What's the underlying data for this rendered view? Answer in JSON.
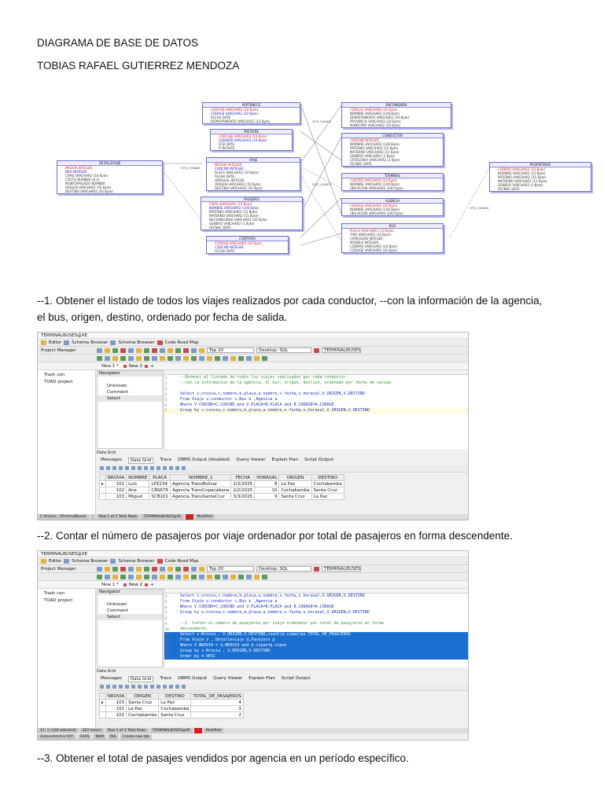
{
  "title": "DIAGRAMA DE BASE DE DATOS",
  "author": "TOBIAS RAFAEL  GUTIERREZ MENDOZA",
  "diagram": {
    "entities": [
      {
        "name": "DETALLEVIAJE",
        "cols": [
          "NROVIA  INTEGER",
          "NRO  INTEGER",
          "CIPAS  VARCHAR2 (10 Byte)",
          "COSTO  NUMBER (6,2)",
          "MONTOPAGADO  NUMBER",
          "ORIGEN  VARCHAR2 (50 Byte)",
          "DESTINO  VARCHAR2 (50 Byte)"
        ]
      },
      {
        "name": "PERTENECE",
        "cols": [
          "CODCAR  VARCHAR2 (10 Byte)",
          "CODAGE  VARCHAR2 (10 Byte)",
          "FECHA  DATE",
          "DEPARTAMENTO  VARCHAR2 (10 Byte)"
        ]
      },
      {
        "name": "PREFIERE",
        "cols": [
          "CODCAJE  VARCHAR2 (10 Byte)",
          "CODHERI  VARCHAR2 (10 Byte)",
          "FFEI  DATE",
          "FFIN  DATE"
        ]
      },
      {
        "name": "VIAJE",
        "cols": [
          "NROVIA  INTEGER",
          "CODCND  INTEGER",
          "PLACA  VARCHAR2 (10 Byte)",
          "FECHA  DATE",
          "HORASAL  INTEGER",
          "ORIGEN  VARCHAR2 (50 Byte)",
          "DESTINO  VARCHAR2 (50 Byte)"
        ]
      },
      {
        "name": "PASAJERO",
        "cols": [
          "CIPAS  VARCHAR2 (10 Byte)",
          "NOMBRE  VARCHAR2 (100 Byte)",
          "PATERNO  VARCHAR2 (15 Byte)",
          "MATERNO  VARCHAR2 (15 Byte)",
          "NACIONALIDAD  VARCHAR2 (20 Byte)",
          "GENERO  VARCHAR2 (1 Byte)",
          "FECNAC  DATE"
        ]
      },
      {
        "name": "CONTRATA",
        "cols": [
          "CODAGE  VARCHAR2 (10 Byte)",
          "CODCND  INTEGER",
          "FECHA  DATE"
        ]
      },
      {
        "name": "ENCOMIENDA",
        "cols": [
          "CODLUG  VARCHAR2 (10 Byte)",
          "NOMBRE  VARCHAR2 (100 Byte)",
          "DEPARTAMENTO  VARCHAR2 (20 Byte)",
          "PROVINCIA  VARCHAR2 (20 Byte)",
          "MUNICIPIO  VARCHAR2 (20 Byte)"
        ]
      },
      {
        "name": "CONDUCTOR",
        "cols": [
          "CODCND  INTEGER",
          "NOMBRE  VARCHAR2 (100 Byte)",
          "PATERNO  VARCHAR2 (15 Byte)",
          "MATERNO  VARCHAR2 (15 Byte)",
          "GENERO  VARCHAR2 (1 Byte)",
          "CATEGORIA  VARCHAR2 (1 Byte)",
          "FECNAC  DATE"
        ]
      },
      {
        "name": "TERMINAL",
        "cols": [
          "CODTER  VARCHAR2 (10 Byte)",
          "NOMBRE  VARCHAR2 (100 Byte)",
          "UBICACION  VARCHAR2 (200 Byte)"
        ]
      },
      {
        "name": "AGENCIA",
        "cols": [
          "CODAGE  VARCHAR2 (10 Byte)",
          "NOMBRE  VARCHAR2 (100 Byte)",
          "UBICACION  VARCHAR2 (200 Byte)"
        ]
      },
      {
        "name": "BUS",
        "cols": [
          "PLACA  VARCHAR2 (10 Byte)",
          "TIPO  VARCHAR2 (10 Byte)",
          "CAPACIDAD  INTEGER",
          "MODELO  INTEGER",
          "CODPRO  VARCHAR2 (10 Byte)",
          "CODAGE  VARCHAR2 (10 Byte)"
        ]
      },
      {
        "name": "PROPIETARIO",
        "cols": [
          "CODPRO  VARCHAR2 (10 Byte)",
          "NOMBRE  VARCHAR2 (15 Byte)",
          "PATERNO  VARCHAR2 (15 Byte)",
          "MATERNO  VARCHAR2 (15 Byte)",
          "GENERO  VARCHAR2 (1 Byte)",
          "FECNAC  DATE"
        ]
      }
    ],
    "links": [
      "SYS_C00869",
      "SYS_C00874",
      "SYS_C00871",
      "SYS_C00878"
    ]
  },
  "q1": {
    "line1": "--1. Obtener el listado de todos los viajes realizados por cada conductor, --con la información de la agencia,",
    "line2": "el bus, origen, destino, ordenado por fecha de salida.",
    "window_title": "TERMINALBUSES@XE",
    "toolbar": {
      "editor": "Editor",
      "schema": "Schema Browser",
      "schema2": "Schema Browser",
      "roadmap": "Code Road Map",
      "top": "Top 20",
      "desktop": "Desktop: SQL",
      "conn": "TERMINALBUSES"
    },
    "project": {
      "title": "Project Manager",
      "items": [
        "Trash can",
        "TOAD project"
      ]
    },
    "tabs": [
      "New 1 *",
      "New 2"
    ],
    "navigator": {
      "title": "Navigator",
      "items": [
        "Unknown",
        "Comment",
        "Select"
      ]
    },
    "sql": [
      {
        "n": "1",
        "t": "--Obtener el listado de todos los viajes realizados por cada conductor,",
        "c": true
      },
      {
        "n": "2",
        "t": "--con la informacion de la agencia, el bus, origen, destino, ordenado por fecha de salida",
        "c": true
      },
      {
        "n": "3",
        "t": ""
      },
      {
        "n": "4",
        "t": "Select v.nrovia,c.nombre,b.placa,a.nombre,v.fecha,v.horasal,V.ORIGEN,V.DESTINO"
      },
      {
        "n": "5",
        "t": "From Viaje v,conductor c,Bus b ,Agencia a"
      },
      {
        "n": "6",
        "t": "Where V.CODCND=C.CODCND and V.PLACA=B.PLACA and B.CODAGE=A.CODAGE"
      },
      {
        "n": "7",
        "t": "Group by v.nrovia,c.nombre,b.placa,a.nombre,v.fecha,v.horasal,V.ORIGEN,V.DESTINO"
      }
    ],
    "grid_label": "Data Grid",
    "result_tabs": [
      "Messages",
      "Data Grid",
      "Trace",
      "DBMS Output (disabled)",
      "Query Viewer",
      "Explain Plan",
      "Script Output"
    ],
    "columns": [
      "NROVIA",
      "NOMBRE",
      "PLACA",
      "NOMBRE_1",
      "FECHA",
      "HORASAL",
      "ORIGEN",
      "DESTINO"
    ],
    "rows": [
      [
        "101",
        "Luis",
        "LPZ234",
        "Agencia TransBolivar",
        "1/2/2025",
        "8",
        "La Paz",
        "Cochabamba"
      ],
      [
        "102",
        "Ana",
        "CBS678",
        "Agencia TransCopacabana",
        "2/2/2025",
        "10",
        "Cochabamba",
        "Santa Cruz"
      ],
      [
        "103",
        "Miguel",
        "SCB101",
        "Agencia TransSantaCruz",
        "3/3/2025",
        "9",
        "Santa Cruz",
        "La Paz"
      ]
    ],
    "status": [
      "C:\\Users\\...\\TerminalBuses",
      "",
      "Row 1 of 3 Total Rows",
      "TERMINALBUSES@XE",
      "",
      "Modified"
    ]
  },
  "q2": {
    "line1": "--2. Contar el número de pasajeros por viaje ordenador por total de pasajeros en forma descendente.",
    "window_title": "TERMINALBUSES@XE",
    "toolbar": {
      "editor": "Editor",
      "schema": "Schema Browser",
      "schema2": "Schema Browser",
      "roadmap": "Code Road Map",
      "top": "Top 20",
      "desktop": "Desktop: SQL",
      "conn": "TERMINALBUSES"
    },
    "project": {
      "title": "Project Manager",
      "items": [
        "Trash can",
        "TOAD project"
      ]
    },
    "tabs": [
      "New 1 *",
      "New 2"
    ],
    "navigator": {
      "title": "Navigator",
      "items": [
        "Unknown",
        "Comment",
        "Select"
      ]
    },
    "sql": [
      {
        "n": "4",
        "t": "Select v.nrovia,c.nombre,b.placa,a.nombre,v.fecha,v.horasal,V.ORIGEN,V.DESTINO"
      },
      {
        "n": "5",
        "t": "From Viaje v,conductor c,Bus b ,Agencia a"
      },
      {
        "n": "6",
        "t": "Where V.CODCND=C.CODCND and V.PLACA=B.PLACA and B.CODAGE=A.CODAGE"
      },
      {
        "n": "7",
        "t": "Group by v.nrovia,c.nombre,b.placa,a.nombre,v.fecha,v.horasal,V.ORIGEN,V.DESTINO"
      },
      {
        "n": "8",
        "t": ""
      },
      {
        "n": "9",
        "t": "--2. Contar el numero de pasajeros por viaje ordenador por total de pasajeros en forma",
        "c": true
      },
      {
        "n": "10",
        "t": "descendente.",
        "c": true
      },
      {
        "n": "11",
        "t": "Select v.Nrovia , V.ORIGEN,V.DESTINO,count(p.cipas)as TOTAL_DE_PASAJEROS",
        "s": true
      },
      {
        "n": "12",
        "t": "From Viaje v , Detalleviaje d,Pasajero p",
        "s": true
      },
      {
        "n": "13",
        "t": "Where V.NROVIA = d.NROVIA and d.cipas=p.cipas",
        "s": true
      },
      {
        "n": "14",
        "t": "Group by v.Nrovia , V.ORIGEN,V.DESTINO",
        "s": true
      },
      {
        "n": "15",
        "t": "Order by 4 DESC",
        "s": true
      }
    ],
    "grid_label": "Data Grid",
    "result_tabs": [
      "Messages",
      "Data Grid",
      "Trace",
      "DBMS Output",
      "Query Viewer",
      "Explain Plan",
      "Script Output"
    ],
    "columns": [
      "NROVIA",
      "ORIGEN",
      "DESTINO",
      "TOTAL_DE_PASAJEROS"
    ],
    "rows": [
      [
        "103",
        "Santa Cruz",
        "La Paz",
        "4"
      ],
      [
        "101",
        "La Paz",
        "Cochabamba",
        "3"
      ],
      [
        "102",
        "Cochabamba",
        "Santa Cruz",
        "2"
      ]
    ],
    "status": [
      "11: 1 (128 selected)",
      "163 msecs",
      "Row 1 of 3 Total Rows",
      "TERMINALBUSES@XE",
      "",
      "Modified"
    ],
    "status2": [
      "Autocommit is OFF",
      "CAPS",
      "NUM",
      "INS",
      "Create new tab"
    ]
  },
  "q3": {
    "line1": "--3. Obtener el total de pasajes vendidos por agencia en un período específico."
  }
}
